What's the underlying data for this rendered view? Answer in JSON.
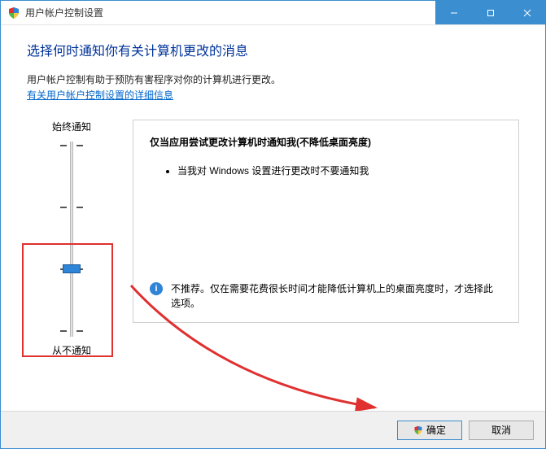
{
  "window": {
    "title": "用户帐户控制设置"
  },
  "heading": "选择何时通知你有关计算机更改的消息",
  "description": "用户帐户控制有助于预防有害程序对你的计算机进行更改。",
  "link_text": "有关用户帐户控制设置的详细信息",
  "slider": {
    "top_label": "始终通知",
    "bottom_label": "从不通知",
    "levels": 4,
    "current_level": 1
  },
  "panel": {
    "title": "仅当应用尝试更改计算机时通知我(不降低桌面亮度)",
    "bullets": [
      "当我对 Windows 设置进行更改时不要通知我"
    ],
    "note": "不推荐。仅在需要花费很长时间才能降低计算机上的桌面亮度时，才选择此选项。"
  },
  "buttons": {
    "ok": "确定",
    "cancel": "取消"
  },
  "icons": {
    "shield": "shield-icon",
    "info": "i"
  }
}
